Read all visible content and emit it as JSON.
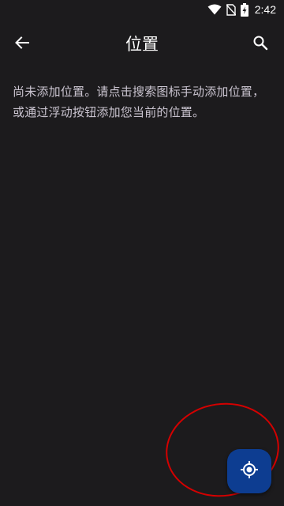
{
  "status_bar": {
    "time": "2:42",
    "icons": [
      "wifi-icon",
      "no-sim-icon",
      "battery-charging-icon"
    ]
  },
  "app_bar": {
    "title": "位置",
    "back_icon": "arrow-back-icon",
    "search_icon": "search-icon"
  },
  "main": {
    "empty_message": "尚未添加位置。请点击搜索图标手动添加位置，或通过浮动按钮添加您当前的位置。"
  },
  "fab": {
    "icon": "my-location-icon",
    "color": "#0d3d91"
  },
  "colors": {
    "background": "#1c1b1d",
    "annotation": "#d40000"
  }
}
